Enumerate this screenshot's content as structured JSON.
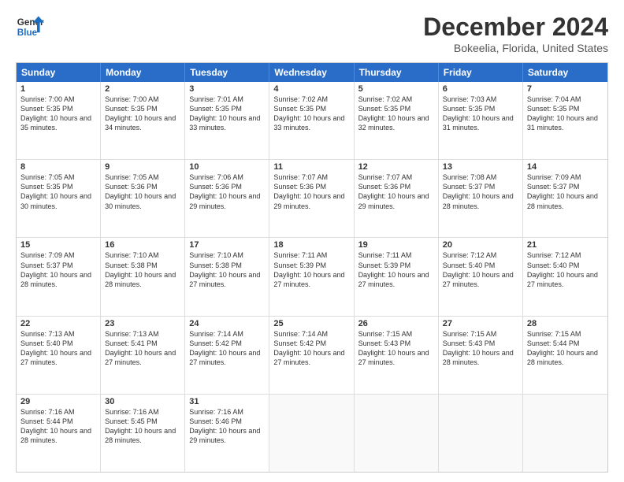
{
  "header": {
    "logo_line1": "General",
    "logo_line2": "Blue",
    "title": "December 2024",
    "subtitle": "Bokeelia, Florida, United States"
  },
  "days": [
    "Sunday",
    "Monday",
    "Tuesday",
    "Wednesday",
    "Thursday",
    "Friday",
    "Saturday"
  ],
  "weeks": [
    [
      {
        "num": "1",
        "sunrise": "7:00 AM",
        "sunset": "5:35 PM",
        "daylight": "10 hours and 35 minutes."
      },
      {
        "num": "2",
        "sunrise": "7:00 AM",
        "sunset": "5:35 PM",
        "daylight": "10 hours and 34 minutes."
      },
      {
        "num": "3",
        "sunrise": "7:01 AM",
        "sunset": "5:35 PM",
        "daylight": "10 hours and 33 minutes."
      },
      {
        "num": "4",
        "sunrise": "7:02 AM",
        "sunset": "5:35 PM",
        "daylight": "10 hours and 33 minutes."
      },
      {
        "num": "5",
        "sunrise": "7:02 AM",
        "sunset": "5:35 PM",
        "daylight": "10 hours and 32 minutes."
      },
      {
        "num": "6",
        "sunrise": "7:03 AM",
        "sunset": "5:35 PM",
        "daylight": "10 hours and 31 minutes."
      },
      {
        "num": "7",
        "sunrise": "7:04 AM",
        "sunset": "5:35 PM",
        "daylight": "10 hours and 31 minutes."
      }
    ],
    [
      {
        "num": "8",
        "sunrise": "7:05 AM",
        "sunset": "5:35 PM",
        "daylight": "10 hours and 30 minutes."
      },
      {
        "num": "9",
        "sunrise": "7:05 AM",
        "sunset": "5:36 PM",
        "daylight": "10 hours and 30 minutes."
      },
      {
        "num": "10",
        "sunrise": "7:06 AM",
        "sunset": "5:36 PM",
        "daylight": "10 hours and 29 minutes."
      },
      {
        "num": "11",
        "sunrise": "7:07 AM",
        "sunset": "5:36 PM",
        "daylight": "10 hours and 29 minutes."
      },
      {
        "num": "12",
        "sunrise": "7:07 AM",
        "sunset": "5:36 PM",
        "daylight": "10 hours and 29 minutes."
      },
      {
        "num": "13",
        "sunrise": "7:08 AM",
        "sunset": "5:37 PM",
        "daylight": "10 hours and 28 minutes."
      },
      {
        "num": "14",
        "sunrise": "7:09 AM",
        "sunset": "5:37 PM",
        "daylight": "10 hours and 28 minutes."
      }
    ],
    [
      {
        "num": "15",
        "sunrise": "7:09 AM",
        "sunset": "5:37 PM",
        "daylight": "10 hours and 28 minutes."
      },
      {
        "num": "16",
        "sunrise": "7:10 AM",
        "sunset": "5:38 PM",
        "daylight": "10 hours and 28 minutes."
      },
      {
        "num": "17",
        "sunrise": "7:10 AM",
        "sunset": "5:38 PM",
        "daylight": "10 hours and 27 minutes."
      },
      {
        "num": "18",
        "sunrise": "7:11 AM",
        "sunset": "5:39 PM",
        "daylight": "10 hours and 27 minutes."
      },
      {
        "num": "19",
        "sunrise": "7:11 AM",
        "sunset": "5:39 PM",
        "daylight": "10 hours and 27 minutes."
      },
      {
        "num": "20",
        "sunrise": "7:12 AM",
        "sunset": "5:40 PM",
        "daylight": "10 hours and 27 minutes."
      },
      {
        "num": "21",
        "sunrise": "7:12 AM",
        "sunset": "5:40 PM",
        "daylight": "10 hours and 27 minutes."
      }
    ],
    [
      {
        "num": "22",
        "sunrise": "7:13 AM",
        "sunset": "5:40 PM",
        "daylight": "10 hours and 27 minutes."
      },
      {
        "num": "23",
        "sunrise": "7:13 AM",
        "sunset": "5:41 PM",
        "daylight": "10 hours and 27 minutes."
      },
      {
        "num": "24",
        "sunrise": "7:14 AM",
        "sunset": "5:42 PM",
        "daylight": "10 hours and 27 minutes."
      },
      {
        "num": "25",
        "sunrise": "7:14 AM",
        "sunset": "5:42 PM",
        "daylight": "10 hours and 27 minutes."
      },
      {
        "num": "26",
        "sunrise": "7:15 AM",
        "sunset": "5:43 PM",
        "daylight": "10 hours and 27 minutes."
      },
      {
        "num": "27",
        "sunrise": "7:15 AM",
        "sunset": "5:43 PM",
        "daylight": "10 hours and 28 minutes."
      },
      {
        "num": "28",
        "sunrise": "7:15 AM",
        "sunset": "5:44 PM",
        "daylight": "10 hours and 28 minutes."
      }
    ],
    [
      {
        "num": "29",
        "sunrise": "7:16 AM",
        "sunset": "5:44 PM",
        "daylight": "10 hours and 28 minutes."
      },
      {
        "num": "30",
        "sunrise": "7:16 AM",
        "sunset": "5:45 PM",
        "daylight": "10 hours and 28 minutes."
      },
      {
        "num": "31",
        "sunrise": "7:16 AM",
        "sunset": "5:46 PM",
        "daylight": "10 hours and 29 minutes."
      },
      null,
      null,
      null,
      null
    ]
  ]
}
